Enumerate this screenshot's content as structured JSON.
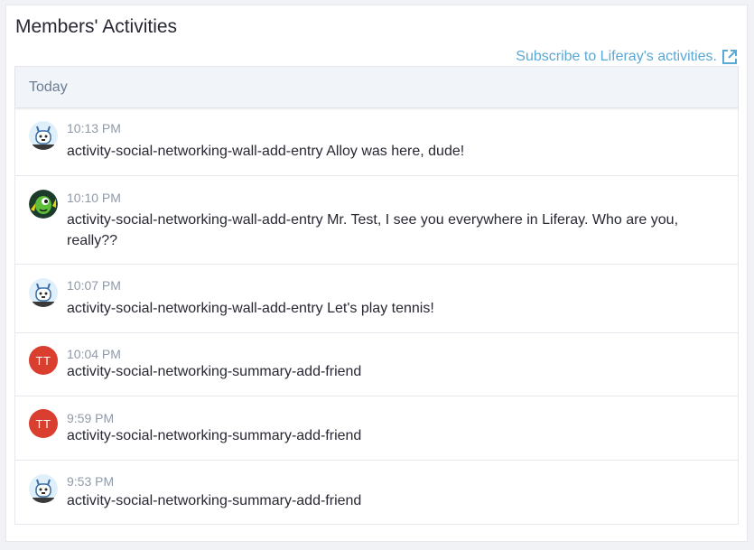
{
  "portlet": {
    "title": "Members' Activities",
    "subscribe_label": "Subscribe to Liferay's activities."
  },
  "list": {
    "header": "Today",
    "items": [
      {
        "avatar": "robot-avatar",
        "time": "10:13 PM",
        "text": "activity-social-networking-wall-add-entry Alloy was here, dude!"
      },
      {
        "avatar": "alien-avatar",
        "time": "10:10 PM",
        "text": "activity-social-networking-wall-add-entry Mr. Test, I see you everywhere in Liferay. Who are you, really??"
      },
      {
        "avatar": "robot-avatar",
        "time": "10:07 PM",
        "text": "activity-social-networking-wall-add-entry Let's play tennis!"
      },
      {
        "avatar": "initials-avatar",
        "initials": "TT",
        "time": "10:04 PM",
        "text": "activity-social-networking-summary-add-friend"
      },
      {
        "avatar": "initials-avatar",
        "initials": "TT",
        "time": "9:59 PM",
        "text": "activity-social-networking-summary-add-friend"
      },
      {
        "avatar": "robot-avatar",
        "time": "9:53 PM",
        "text": "activity-social-networking-summary-add-friend"
      }
    ]
  },
  "colors": {
    "link": "#5aa8d6",
    "initials_avatar_bg": "#da3e2f",
    "header_bg": "#f1f5f9"
  }
}
